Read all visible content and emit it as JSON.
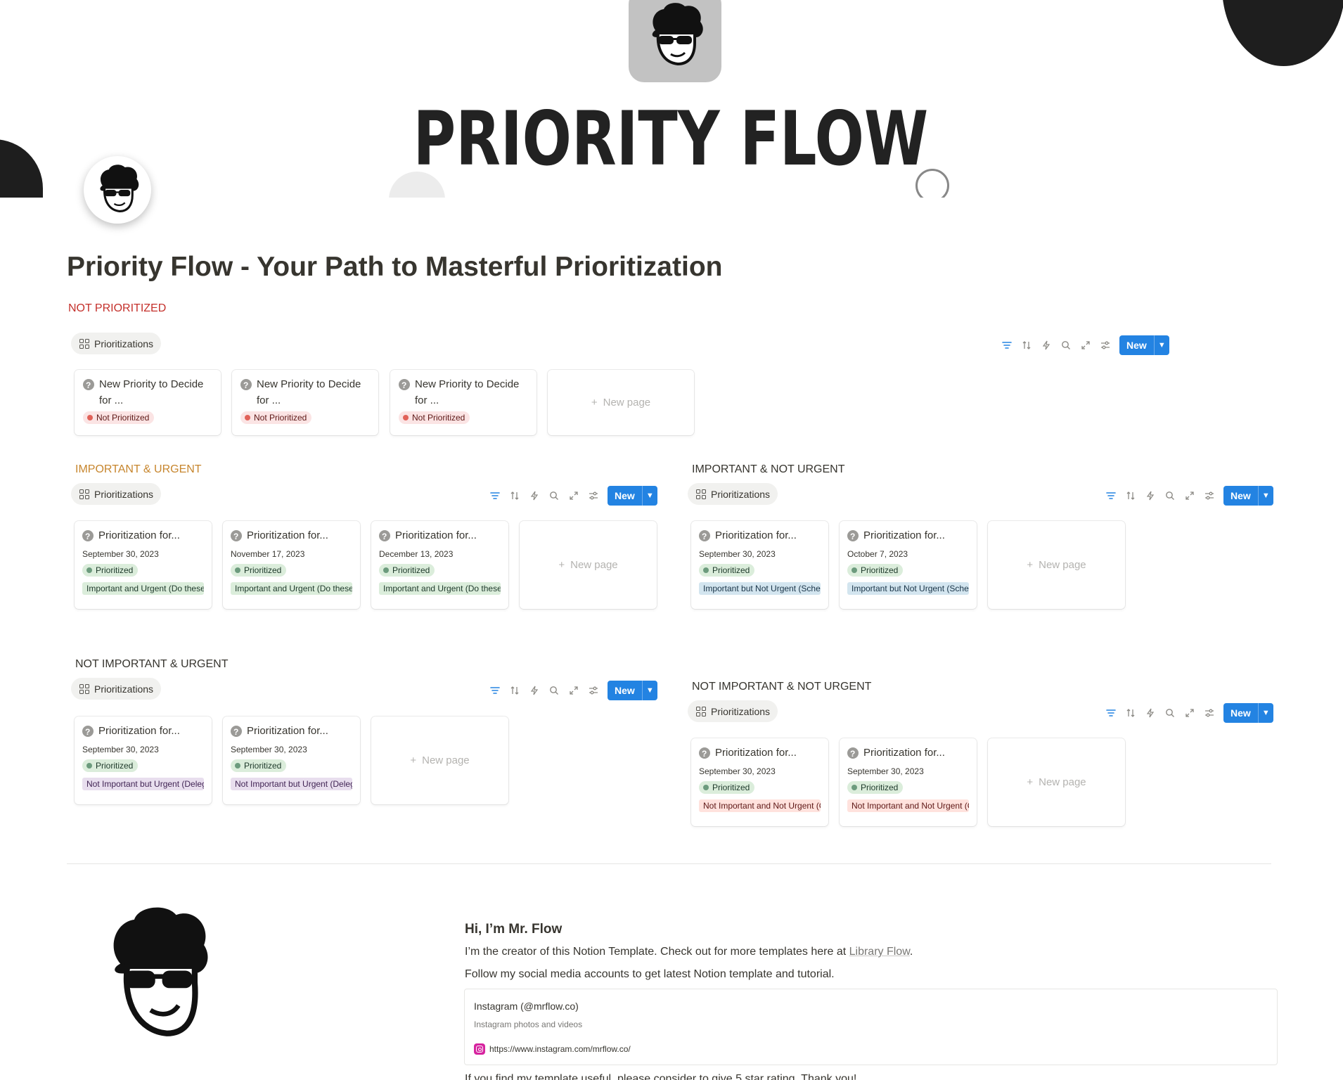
{
  "cover": {
    "title": "PRIORITY FLOW"
  },
  "page": {
    "title": "Priority Flow - Your Path to Masterful Prioritization"
  },
  "toolbar": {
    "new_label": "New"
  },
  "view_tab_label": "Prioritizations",
  "new_page_label": "New page",
  "sections": {
    "not_prioritized": {
      "label": "NOT PRIORITIZED",
      "cards": [
        {
          "title": "New Priority to Decide for ...",
          "status": "Not Prioritized"
        },
        {
          "title": "New Priority to Decide for ...",
          "status": "Not Prioritized"
        },
        {
          "title": "New Priority to Decide for ...",
          "status": "Not Prioritized"
        }
      ]
    },
    "important_urgent": {
      "label": "IMPORTANT & URGENT",
      "cards": [
        {
          "title": "Prioritization for...",
          "date": "September 30, 2023",
          "status": "Prioritized",
          "tag": "Important and Urgent (Do these in"
        },
        {
          "title": "Prioritization for...",
          "date": "November 17, 2023",
          "status": "Prioritized",
          "tag": "Important and Urgent (Do these in"
        },
        {
          "title": "Prioritization for...",
          "date": "December 13, 2023",
          "status": "Prioritized",
          "tag": "Important and Urgent (Do these in"
        }
      ]
    },
    "important_not_urgent": {
      "label": "IMPORTANT & NOT URGENT",
      "cards": [
        {
          "title": "Prioritization for...",
          "date": "September 30, 2023",
          "status": "Prioritized",
          "tag": "Important but Not Urgent (Schedu"
        },
        {
          "title": "Prioritization for...",
          "date": "October 7, 2023",
          "status": "Prioritized",
          "tag": "Important but Not Urgent (Schedu"
        }
      ]
    },
    "not_important_urgent": {
      "label": "NOT IMPORTANT & URGENT",
      "cards": [
        {
          "title": "Prioritization for...",
          "date": "September 30, 2023",
          "status": "Prioritized",
          "tag": "Not Important but Urgent (Delega"
        },
        {
          "title": "Prioritization for...",
          "date": "September 30, 2023",
          "status": "Prioritized",
          "tag": "Not Important but Urgent (Delega"
        }
      ]
    },
    "not_important_not_urgent": {
      "label": "NOT IMPORTANT & NOT URGENT",
      "cards": [
        {
          "title": "Prioritization for...",
          "date": "September 30, 2023",
          "status": "Prioritized",
          "tag": "Not Important and Not Urgent (Co"
        },
        {
          "title": "Prioritization for...",
          "date": "September 30, 2023",
          "status": "Prioritized",
          "tag": "Not Important and Not Urgent (Co"
        }
      ]
    }
  },
  "creator": {
    "heading": "Hi, I’m Mr. Flow",
    "line1_prefix": "I’m the creator of this Notion Template. Check out for more templates here at ",
    "line1_link": "Library Flow",
    "line1_suffix": ".",
    "line2": "Follow my social media accounts to get latest Notion template and tutorial.",
    "bookmark": {
      "title": "Instagram (@mrflow.co)",
      "description": "Instagram photos and videos",
      "url": "https://www.instagram.com/mrflow.co/"
    },
    "line3": "If you find my template useful, please consider to give 5 star rating. Thank you!"
  },
  "colors": {
    "accent_blue": "#2383e2",
    "not_prioritized_red": "#c4302b",
    "important_urgent_orange": "#c7862e",
    "text": "#37352f"
  }
}
